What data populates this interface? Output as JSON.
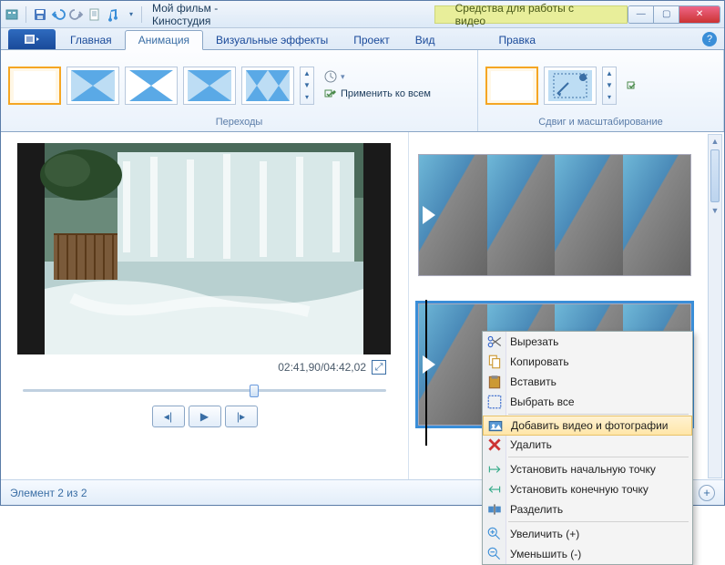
{
  "titlebar": {
    "title": "Мой фильм - Киностудия",
    "contextual_label": "Средства для работы с видео"
  },
  "tabs": {
    "main": "Главная",
    "animation": "Анимация",
    "effects": "Визуальные эффекты",
    "project": "Проект",
    "view": "Вид",
    "edit": "Правка"
  },
  "ribbon": {
    "transitions_group": "Переходы",
    "panzoom_group": "Сдвиг и масштабирование",
    "apply_all": "Применить ко всем"
  },
  "preview": {
    "time": "02:41,90/04:42,02"
  },
  "context_menu": {
    "cut": "Вырезать",
    "copy": "Копировать",
    "paste": "Вставить",
    "select_all": "Выбрать все",
    "add_media": "Добавить видео и фотографии",
    "delete": "Удалить",
    "set_start": "Установить начальную точку",
    "set_end": "Установить конечную точку",
    "split": "Разделить",
    "zoom_in": "Увеличить (+)",
    "zoom_out": "Уменьшить (-)"
  },
  "statusbar": {
    "item_count": "Элемент 2 из 2"
  }
}
